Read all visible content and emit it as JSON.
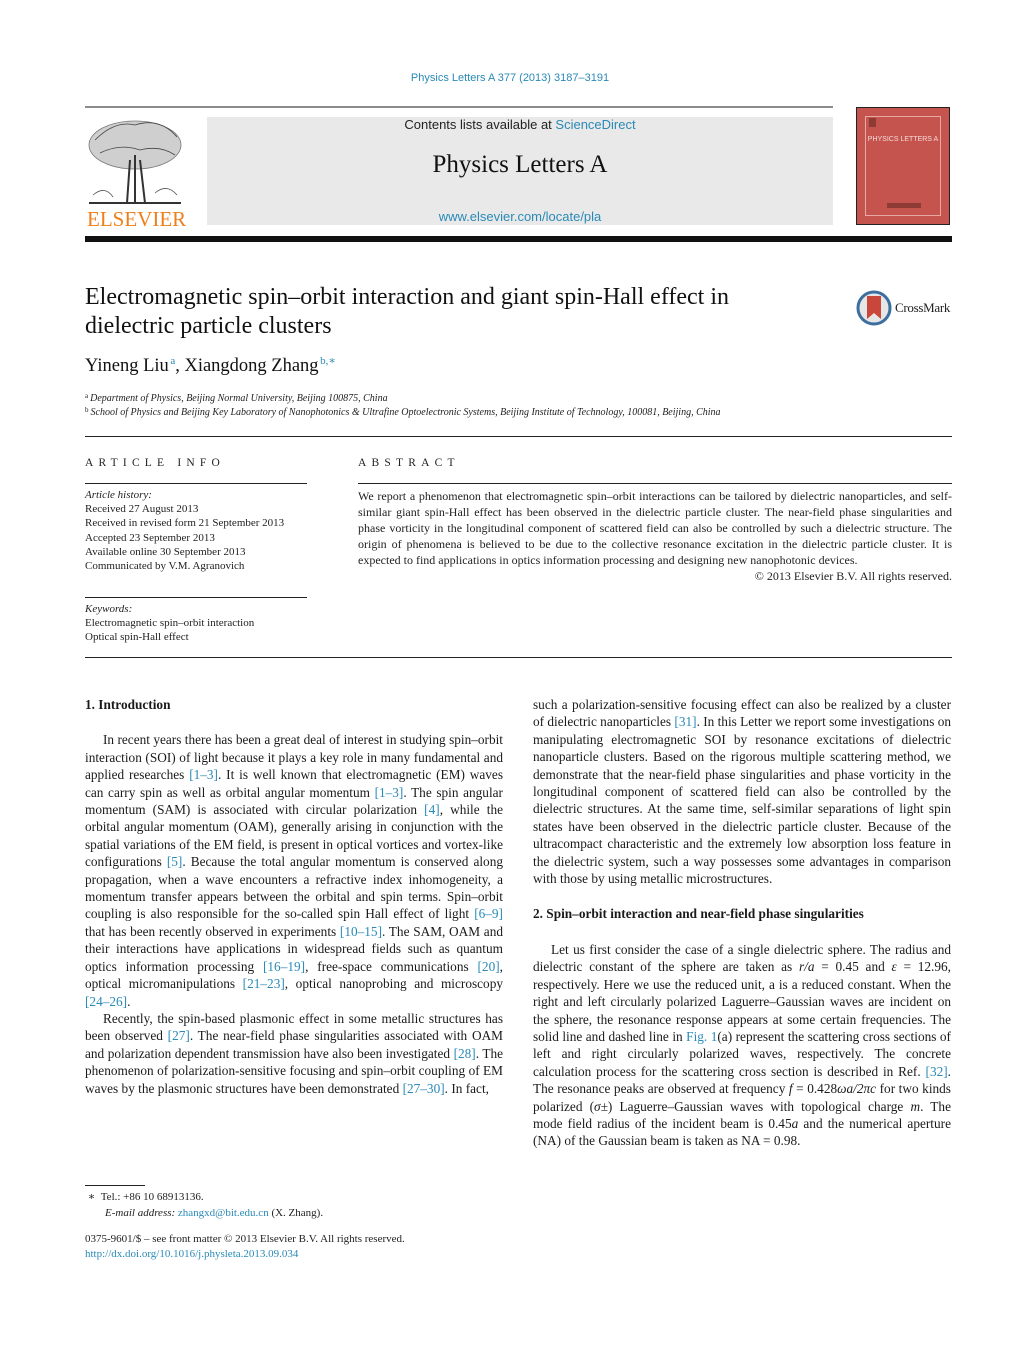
{
  "header": {
    "journal_reference": "Physics Letters A 377 (2013) 3187–3191",
    "contents_prefix": "Contents lists available at ",
    "contents_link": "ScienceDirect",
    "journal_title": "Physics Letters A",
    "journal_url": "www.elsevier.com/locate/pla",
    "publisher_logo_text": "ELSEVIER",
    "cover_title": "PHYSICS LETTERS A",
    "crossmark_label": "CrossMark",
    "colors": {
      "link": "#2a8ab7",
      "publisher_orange": "#f07f1a",
      "cover_red": "#c6544e",
      "banner_gray": "#e9e9e9"
    }
  },
  "article": {
    "title": "Electromagnetic spin–orbit interaction and giant spin-Hall effect in dielectric particle clusters",
    "authors": [
      {
        "name": "Yineng Liu",
        "marks": "a"
      },
      {
        "name": "Xiangdong Zhang",
        "marks": "b,∗"
      }
    ],
    "author_separator": ", ",
    "affiliations": [
      {
        "mark": "a",
        "text": "Department of Physics, Beijing Normal University, Beijing 100875, China"
      },
      {
        "mark": "b",
        "text": "School of Physics and Beijing Key Laboratory of Nanophotonics & Ultrafine Optoelectronic Systems, Beijing Institute of Technology, 100081, Beijing, China"
      }
    ]
  },
  "article_info": {
    "heading": "ARTICLE INFO",
    "history_label": "Article history:",
    "history": [
      "Received 27 August 2013",
      "Received in revised form 21 September 2013",
      "Accepted 23 September 2013",
      "Available online 30 September 2013",
      "Communicated by V.M. Agranovich"
    ],
    "keywords_label": "Keywords:",
    "keywords": [
      "Electromagnetic spin–orbit interaction",
      "Optical spin-Hall effect"
    ]
  },
  "abstract": {
    "heading": "ABSTRACT",
    "text": "We report a phenomenon that electromagnetic spin–orbit interactions can be tailored by dielectric nanoparticles, and self-similar giant spin-Hall effect has been observed in the dielectric particle cluster. The near-field phase singularities and phase vorticity in the longitudinal component of scattered field can also be controlled by such a dielectric structure. The origin of phenomena is believed to be due to the collective resonance excitation in the dielectric particle cluster. It is expected to find applications in optics information processing and designing new nanophotonic devices.",
    "copyright": "© 2013 Elsevier B.V. All rights reserved."
  },
  "body": {
    "section1": {
      "heading": "1. Introduction",
      "p1": [
        "In recent years there has been a great deal of interest in studying spin–orbit interaction (SOI) of light because it plays a key role in many fundamental and applied researches ",
        "[1–3]",
        ". It is well known that electromagnetic (EM) waves can carry spin as well as orbital angular momentum ",
        "[1–3]",
        ". The spin angular momentum (SAM) is associated with circular polarization ",
        "[4]",
        ", while the orbital angular momentum (OAM), generally arising in conjunction with the spatial variations of the EM field, is present in optical vortices and vortex-like configurations ",
        "[5]",
        ". Because the total angular momentum is conserved along propagation, when a wave encounters a refractive index inhomogeneity, a momentum transfer appears between the orbital and spin terms. Spin–orbit coupling is also responsible for the so-called spin Hall effect of light ",
        "[6–9]",
        " that has been recently observed in experiments ",
        "[10–15]",
        ". The SAM, OAM and their interactions have applications in widespread fields such as quantum optics information processing ",
        "[16–19]",
        ", free-space communications ",
        "[20]",
        ", optical micromanipulations ",
        "[21–23]",
        ", optical nanoprobing and microscopy ",
        "[24–26]",
        "."
      ],
      "p2": [
        "Recently, the spin-based plasmonic effect in some metallic structures has been observed ",
        "[27]",
        ". The near-field phase singularities associated with OAM and polarization dependent transmission have also been investigated ",
        "[28]",
        ". The phenomenon of polarization-sensitive focusing and spin–orbit coupling of EM waves by the plasmonic structures have been demonstrated ",
        "[27–30]",
        ". In fact,"
      ],
      "p3": [
        "such a polarization-sensitive focusing effect can also be realized by a cluster of dielectric nanoparticles ",
        "[31]",
        ". In this Letter we report some investigations on manipulating electromagnetic SOI by resonance excitations of dielectric nanoparticle clusters. Based on the rigorous multiple scattering method, we demonstrate that the near-field phase singularities and phase vorticity in the longitudinal component of scattered field can also be controlled by the dielectric structures. At the same time, self-similar separations of light spin states have been observed in the dielectric particle cluster. Because of the ultracompact characteristic and the extremely low absorption loss feature in the dielectric system, such a way possesses some advantages in comparison with those by using metallic microstructures."
      ]
    },
    "section2": {
      "heading": "2. Spin–orbit interaction and near-field phase singularities",
      "p1": [
        "Let us first consider the case of a single dielectric sphere. The radius and dielectric constant of the sphere are taken as ",
        "r/a",
        " = 0.45 and ",
        "ε",
        " = 12.96, respectively. Here we use the reduced unit, a is a reduced constant. When the right and left circularly polarized Laguerre–Gaussian waves are incident on the sphere, the resonance response appears at some certain frequencies. The solid line and dashed line in ",
        "Fig. 1",
        "(a) represent the scattering cross sections of left and right circularly polarized waves, respectively. The concrete calculation process for the scattering cross section is described in Ref. ",
        "[32]",
        ". The resonance peaks are observed at frequency ",
        "f",
        " = 0.428",
        "ωa/2πc",
        " for two kinds polarized (",
        "σ±",
        ") Laguerre–Gaussian waves with topological charge ",
        "m",
        ". The mode field radius of the incident beam is 0.45",
        "a",
        " and the numerical aperture (NA) of the Gaussian beam is taken as NA = 0.98."
      ]
    }
  },
  "footnotes": {
    "tel_mark": "∗",
    "tel": "Tel.: +86 10 68913136.",
    "email_label": "E-mail address: ",
    "email": "zhangxd@bit.edu.cn",
    "email_suffix": " (X. Zhang)."
  },
  "front_matter": {
    "issn_line": "0375-9601/$ – see front matter  © 2013 Elsevier B.V. All rights reserved.",
    "doi": "http://dx.doi.org/10.1016/j.physleta.2013.09.034"
  }
}
